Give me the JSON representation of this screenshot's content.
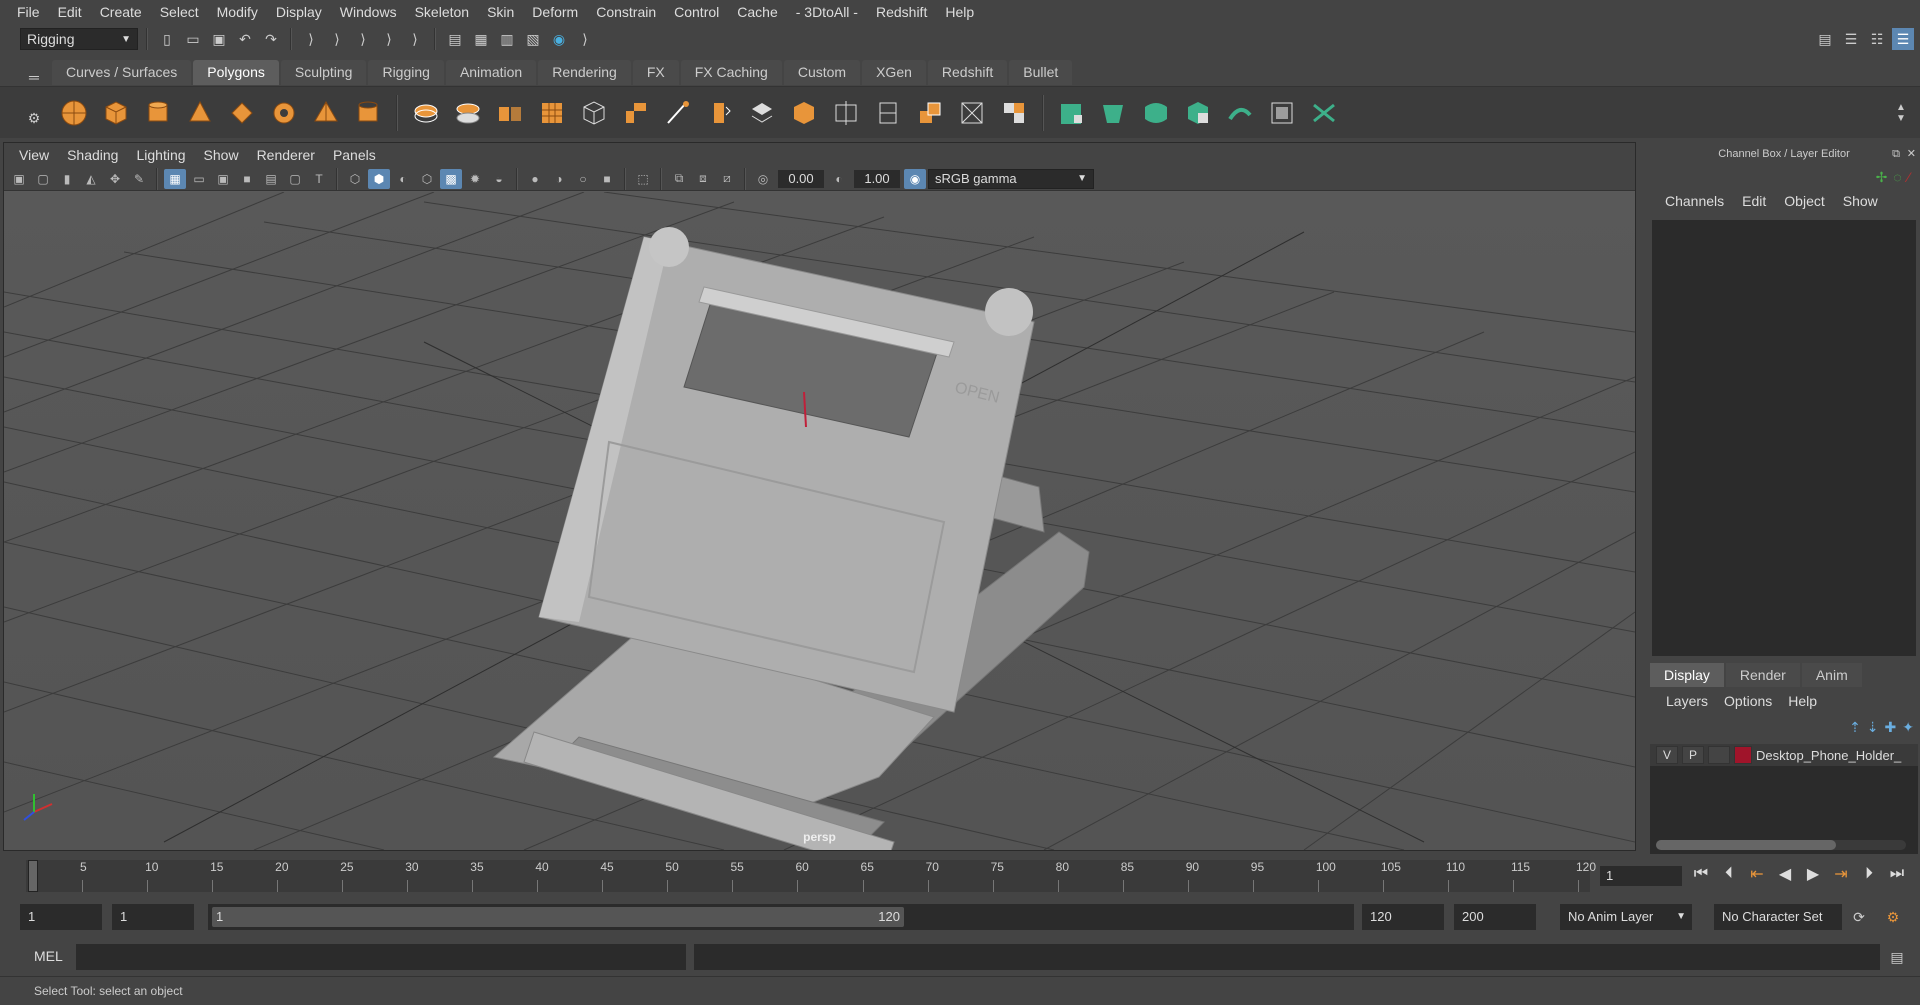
{
  "menu": [
    "File",
    "Edit",
    "Create",
    "Select",
    "Modify",
    "Display",
    "Windows",
    "Skeleton",
    "Skin",
    "Deform",
    "Constrain",
    "Control",
    "Cache",
    "- 3DtoAll -",
    "Redshift",
    "Help"
  ],
  "statusline": {
    "menuset": "Rigging"
  },
  "shelf_tabs": [
    "Curves / Surfaces",
    "Polygons",
    "Sculpting",
    "Rigging",
    "Animation",
    "Rendering",
    "FX",
    "FX Caching",
    "Custom",
    "XGen",
    "Redshift",
    "Bullet"
  ],
  "shelf_active_tab": "Polygons",
  "viewport": {
    "menu": [
      "View",
      "Shading",
      "Lighting",
      "Show",
      "Renderer",
      "Panels"
    ],
    "exposure": "0.00",
    "gamma": "1.00",
    "colorspace": "sRGB gamma",
    "camera": "persp",
    "model_label": "OPEN"
  },
  "channel_box": {
    "title": "Channel Box / Layer Editor",
    "menu": [
      "Channels",
      "Edit",
      "Object",
      "Show"
    ]
  },
  "layer_editor": {
    "tabs": [
      "Display",
      "Render",
      "Anim"
    ],
    "menu": [
      "Layers",
      "Options",
      "Help"
    ],
    "layer": {
      "v": "V",
      "p": "P",
      "name": "Desktop_Phone_Holder_",
      "color": "#a0142a"
    }
  },
  "timeline": {
    "ticks": [
      "1",
      "5",
      "10",
      "15",
      "20",
      "25",
      "30",
      "35",
      "40",
      "45",
      "50",
      "55",
      "60",
      "65",
      "70",
      "75",
      "80",
      "85",
      "90",
      "95",
      "100",
      "105",
      "110",
      "115",
      "120"
    ],
    "current_frame": "1"
  },
  "range": {
    "start": "1",
    "start_inner": "1",
    "slider_start": "1",
    "slider_end": "120",
    "end_inner": "120",
    "end": "200",
    "anim_layer": "No Anim Layer",
    "char_set": "No Character Set"
  },
  "command": {
    "lang": "MEL"
  },
  "help_line": "Select Tool: select an object"
}
